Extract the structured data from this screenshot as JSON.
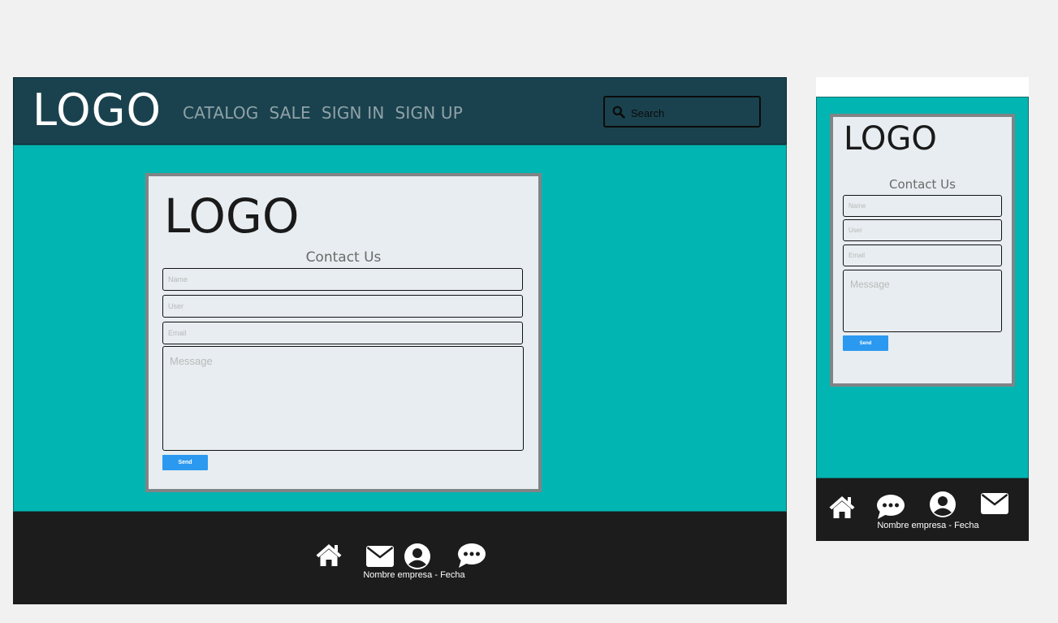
{
  "desktop": {
    "header": {
      "logo": "LOGO",
      "nav": [
        "CATALOG",
        "SALE",
        "SIGN IN",
        "SIGN UP"
      ],
      "search_placeholder": "Search",
      "search_icon": "search-icon"
    },
    "form": {
      "logo": "LOGO",
      "title": "Contact Us",
      "name_placeholder": "Name",
      "user_placeholder": "User",
      "email_placeholder": "Email",
      "message_placeholder": "Message",
      "send_label": "Send"
    },
    "footer": {
      "icons": [
        "home-icon",
        "envelope-icon",
        "user-circle-icon",
        "chat-icon"
      ],
      "copyright": "Nombre empresa - Fecha"
    }
  },
  "mobile": {
    "form": {
      "logo": "LOGO",
      "title": "Contact Us",
      "name_placeholder": "Name",
      "user_placeholder": "User",
      "email_placeholder": "Email",
      "message_placeholder": "Message",
      "send_label": "Send"
    },
    "footer": {
      "icons": [
        "home-icon",
        "chat-icon",
        "user-circle-icon",
        "envelope-icon"
      ],
      "copyright": "Nombre empresa - Fecha"
    }
  },
  "colors": {
    "header_bg": "#1a424e",
    "main_bg": "#00b5b2",
    "card_bg": "#e7edf0",
    "footer_bg": "#1c1c1c",
    "button": "#2b99f0",
    "nav_text": "#8fa2a8"
  }
}
